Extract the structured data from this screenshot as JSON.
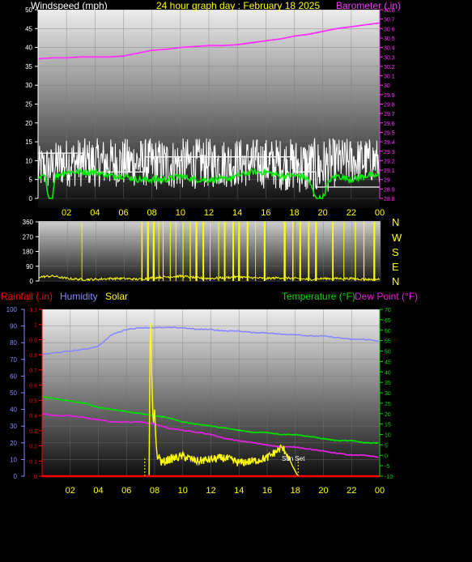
{
  "header": {
    "wind_title": "Windspeed (mph)",
    "graph_title": "24 hour graph day : February 18 2025",
    "baro_title": "Barometer (.in)"
  },
  "lower_header": {
    "rain_title": "Rainfall (.in)",
    "humidity_title": "Humidity",
    "solar_title": "Solar",
    "temp_title": "Temperature (°F)",
    "dew_title": "Dew Point (°F)"
  },
  "compass": [
    "N",
    "W",
    "S",
    "E",
    "N"
  ],
  "annotation": {
    "text": "Sun Set"
  },
  "colors": {
    "wind": "#ffffff",
    "gust": "#ffffff",
    "avgwind": "#00ee00",
    "baro": "#ff33ff",
    "winddir": "#ffff00",
    "humidity": "#8888ff",
    "temperature": "#00dd00",
    "dewpoint": "#dd22dd",
    "solar": "#ffff00",
    "rain": "#ff0000",
    "wind_axis": "#ffffff",
    "baro_axis": "#ff33ff",
    "x_axis": "#ffff00"
  },
  "chart_data": [
    {
      "type": "line",
      "title": "24 hour graph day : February 18 2025",
      "x_ticks": [
        "02",
        "04",
        "06",
        "08",
        "10",
        "12",
        "14",
        "16",
        "18",
        "20",
        "22",
        "00"
      ],
      "y_left": {
        "label": "Windspeed (mph)",
        "ylim": [
          0,
          50
        ],
        "ticks": [
          "0",
          "5",
          "10",
          "15",
          "20",
          "25",
          "30",
          "35",
          "40",
          "45",
          "50"
        ]
      },
      "y_right": {
        "label": "Barometer (.in)",
        "ylim": [
          28.8,
          30.8
        ],
        "ticks": [
          "28.8",
          "28.9",
          "29",
          "29.1",
          "29.2",
          "29.3",
          "29.4",
          "29.5",
          "29.6",
          "29.7",
          "29.8",
          "29.9",
          "30",
          "30.1",
          "30.2",
          "30.3",
          "30.4",
          "30.5",
          "30.6",
          "30.7",
          "30.8"
        ]
      },
      "series": [
        {
          "name": "Windspeed",
          "axis": "left",
          "style": "noise",
          "x": [
            0,
            1,
            1.5,
            1.6,
            6.5,
            6.6,
            7.6,
            8.2,
            14.2,
            14.4,
            17.5,
            17.7,
            19.5,
            19.7,
            21.3,
            21.5,
            24
          ],
          "low": [
            2,
            2,
            3,
            3,
            3,
            3,
            3,
            2,
            3,
            3,
            2,
            2,
            0,
            0,
            4,
            4,
            4
          ],
          "high": [
            14,
            14,
            16,
            16,
            16,
            16,
            16,
            16,
            16,
            16,
            16,
            16,
            16,
            16,
            16,
            16,
            16
          ]
        },
        {
          "name": "Avg wind",
          "axis": "left",
          "x": [
            0,
            0.5,
            0.7,
            1,
            1.2,
            2,
            3,
            4,
            5,
            6,
            7,
            8,
            9,
            10,
            11,
            12,
            13,
            14,
            15,
            16,
            17,
            18,
            18.5,
            19,
            19.5,
            20,
            20.5,
            21,
            22,
            23,
            24
          ],
          "values": [
            5,
            6,
            0,
            0,
            6,
            7,
            7,
            7,
            6,
            6,
            5,
            5,
            5,
            6,
            5,
            5,
            5,
            6,
            7,
            7,
            6,
            6,
            6,
            5,
            0,
            0,
            5,
            6,
            5,
            6,
            6
          ]
        },
        {
          "name": "Gust",
          "axis": "left",
          "x": [
            0,
            1,
            2,
            3,
            3.2,
            4,
            6,
            7,
            7.5,
            8,
            12,
            14,
            15,
            16,
            17,
            17.5,
            18,
            18.5,
            19.5,
            21,
            24
          ],
          "values": [
            12,
            12,
            12,
            12,
            7,
            7,
            7,
            7,
            11,
            11,
            11,
            11,
            11,
            11,
            11,
            11,
            7,
            7,
            3,
            3,
            3
          ]
        },
        {
          "name": "Barometer",
          "axis": "right",
          "x": [
            0,
            1,
            2,
            3,
            4,
            5,
            6,
            7,
            8,
            9,
            10,
            11,
            12,
            13,
            14,
            15,
            16,
            17,
            18,
            19,
            20,
            21,
            22,
            23,
            24
          ],
          "values": [
            30.28,
            30.29,
            30.29,
            30.3,
            30.3,
            30.3,
            30.31,
            30.34,
            30.37,
            30.38,
            30.4,
            30.41,
            30.42,
            30.42,
            30.43,
            30.45,
            30.47,
            30.49,
            30.52,
            30.54,
            30.57,
            30.6,
            30.62,
            30.64,
            30.66
          ]
        }
      ]
    },
    {
      "type": "line",
      "x_ticks": [
        "02",
        "04",
        "06",
        "08",
        "10",
        "12",
        "14",
        "16",
        "18",
        "20",
        "22",
        "00"
      ],
      "y": {
        "ylim": [
          0,
          360
        ],
        "ticks": [
          "0",
          "90",
          "180",
          "270",
          "360"
        ]
      },
      "series": [
        {
          "name": "Wind direction",
          "x": [
            0,
            1,
            2,
            3,
            4,
            5,
            6,
            7,
            8,
            9,
            10,
            11,
            12,
            13,
            14,
            15,
            16,
            17,
            18,
            19,
            20,
            21,
            22,
            23,
            24
          ],
          "values": [
            25,
            30,
            15,
            10,
            10,
            15,
            15,
            10,
            20,
            25,
            30,
            20,
            15,
            20,
            25,
            20,
            15,
            20,
            15,
            10,
            15,
            15,
            15,
            10,
            10
          ],
          "spikes": [
            3,
            7.2,
            7.6,
            8,
            8.4,
            8.7,
            9.2,
            9.6,
            10.1,
            10.6,
            11,
            11.5,
            12,
            12.6,
            13,
            13.6,
            14,
            14.6,
            15.2,
            15.8,
            17.2,
            17.8,
            18.3,
            18.9,
            19.4,
            20.6,
            21.4,
            22.2,
            22.8,
            23.5
          ]
        }
      ]
    },
    {
      "type": "line",
      "x_ticks": [
        "02",
        "04",
        "06",
        "08",
        "10",
        "12",
        "14",
        "16",
        "18",
        "20",
        "22",
        "00"
      ],
      "y_humidity": {
        "label": "Humidity",
        "ylim": [
          0,
          100
        ],
        "ticks": [
          "0",
          "10",
          "20",
          "30",
          "40",
          "50",
          "60",
          "70",
          "80",
          "90",
          "100"
        ]
      },
      "y_rain": {
        "label": "Rainfall (.in)",
        "ylim": [
          0,
          1.1
        ],
        "ticks": [
          "0",
          "0.1",
          "0.2",
          "0.3",
          "0.4",
          "0.5",
          "0.6",
          "0.7",
          "0.8",
          "0.9",
          "1",
          "1.1"
        ]
      },
      "y_temp": {
        "label": "Temperature (°F)",
        "ylim": [
          -10,
          70
        ],
        "ticks": [
          "-10",
          "-5",
          "0",
          "5",
          "10",
          "15",
          "20",
          "25",
          "30",
          "35",
          "40",
          "45",
          "50",
          "55",
          "60",
          "65",
          "70"
        ]
      },
      "series": [
        {
          "name": "Humidity",
          "axis": "humidity",
          "x": [
            0,
            1,
            2,
            3,
            4,
            5,
            6,
            7,
            8,
            9,
            10,
            11,
            12,
            13,
            14,
            15,
            16,
            17,
            18,
            19,
            20,
            21,
            22,
            23,
            24
          ],
          "values": [
            73,
            74,
            75,
            76,
            78,
            85,
            88,
            89,
            89,
            89,
            89,
            88,
            88,
            87,
            87,
            86,
            86,
            85,
            85,
            84,
            84,
            83,
            82,
            82,
            81
          ]
        },
        {
          "name": "Temperature",
          "axis": "temp",
          "x": [
            0,
            1,
            2,
            3,
            4,
            5,
            6,
            7,
            8,
            9,
            10,
            11,
            12,
            13,
            14,
            15,
            16,
            17,
            18,
            19,
            20,
            21,
            22,
            23,
            24
          ],
          "values": [
            28,
            27,
            26,
            25,
            23,
            22,
            21,
            20,
            19,
            18,
            16,
            15,
            14,
            13,
            12,
            11,
            11,
            10,
            10,
            9,
            8,
            7,
            7,
            6,
            6
          ]
        },
        {
          "name": "Dew Point",
          "axis": "temp",
          "x": [
            0,
            1,
            2,
            3,
            4,
            5,
            6,
            7,
            8,
            9,
            10,
            11,
            12,
            13,
            14,
            15,
            16,
            17,
            18,
            19,
            20,
            21,
            22,
            23,
            24
          ],
          "values": [
            20,
            19,
            19,
            18,
            17,
            16,
            16,
            16,
            15,
            13,
            12,
            11,
            10,
            8,
            7,
            6,
            5,
            4,
            4,
            3,
            2,
            1,
            0,
            0,
            -1
          ]
        },
        {
          "name": "Solar",
          "axis": "humidity",
          "x": [
            0,
            7.3,
            7.6,
            7.7,
            7.8,
            7.9,
            8.0,
            8.1,
            8.2,
            8.3,
            8.5,
            9,
            10,
            11,
            12,
            13,
            14,
            15,
            16,
            16.5,
            17,
            17.3,
            17.6,
            17.8,
            18,
            18.2,
            24
          ],
          "values": [
            0,
            0,
            0,
            100,
            60,
            30,
            40,
            20,
            10,
            12,
            8,
            10,
            12,
            9,
            10,
            11,
            8,
            9,
            11,
            14,
            17,
            15,
            10,
            6,
            3,
            0,
            0
          ]
        },
        {
          "name": "Rainfall",
          "axis": "rain",
          "x": [
            0,
            24
          ],
          "values": [
            0,
            0
          ]
        }
      ]
    }
  ]
}
